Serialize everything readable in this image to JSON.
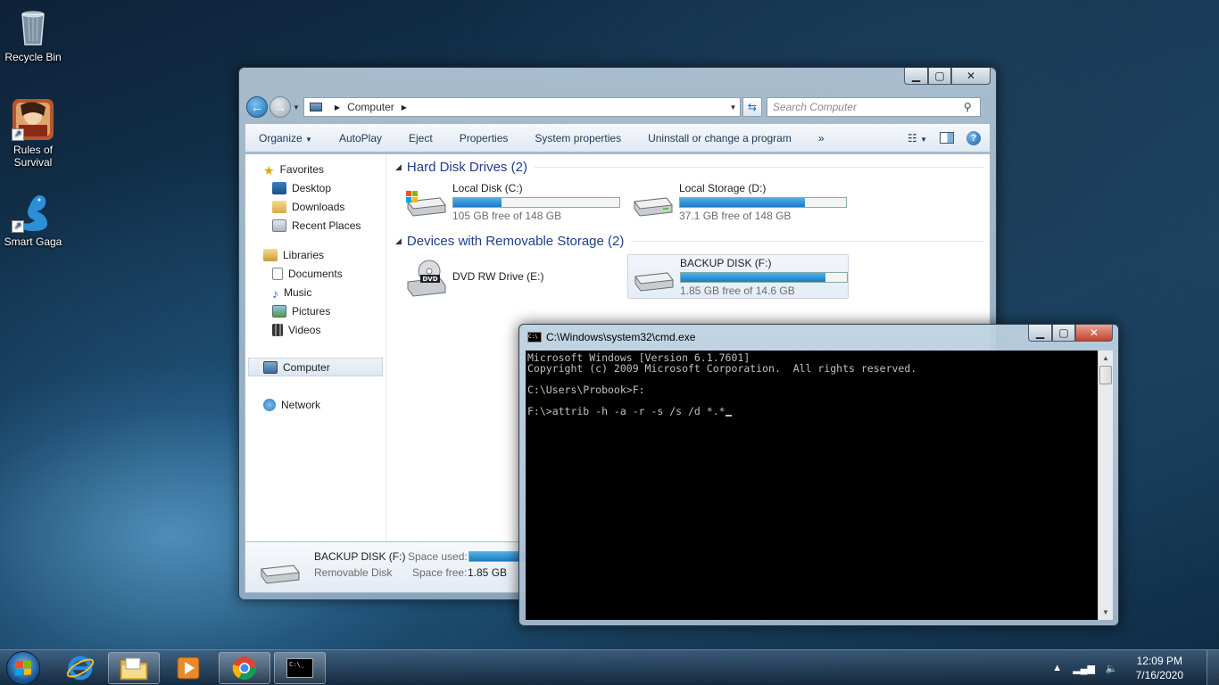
{
  "desktop": {
    "icons": [
      {
        "label": "Recycle Bin",
        "icon": "recycle-bin-icon"
      },
      {
        "label": "Rules of Survival",
        "icon": "rules-of-survival-icon"
      },
      {
        "label": "Smart Gaga",
        "icon": "smart-gaga-icon"
      }
    ]
  },
  "explorer": {
    "address": {
      "location": "Computer"
    },
    "search_placeholder": "Search Computer",
    "toolbar": {
      "organize": "Organize",
      "autoplay": "AutoPlay",
      "eject": "Eject",
      "properties": "Properties",
      "system_properties": "System properties",
      "uninstall": "Uninstall or change a program",
      "more": "»",
      "help": "?"
    },
    "nav": {
      "favorites": "Favorites",
      "desktop": "Desktop",
      "downloads": "Downloads",
      "recent_places": "Recent Places",
      "libraries": "Libraries",
      "documents": "Documents",
      "music": "Music",
      "pictures": "Pictures",
      "videos": "Videos",
      "computer": "Computer",
      "network": "Network"
    },
    "groups": {
      "hdd": "Hard Disk Drives (2)",
      "removable": "Devices with Removable Storage (2)"
    },
    "drives": {
      "c": {
        "name": "Local Disk (C:)",
        "free": "105 GB free of 148 GB",
        "used_fraction": 0.29
      },
      "d": {
        "name": "Local Storage (D:)",
        "free": "37.1 GB free of 148 GB",
        "used_fraction": 0.75
      },
      "e": {
        "name": "DVD RW Drive (E:)",
        "badge": "DVD"
      },
      "f": {
        "name": "BACKUP DISK (F:)",
        "free": "1.85 GB free of 14.6 GB",
        "used_fraction": 0.87
      }
    },
    "details": {
      "name": "BACKUP DISK (F:)",
      "type": "Removable Disk",
      "space_used_label": "Space used:",
      "space_free_label": "Space free:",
      "space_free_value": "1.85 GB",
      "used_fraction": 0.87
    }
  },
  "cmd": {
    "title": "C:\\Windows\\system32\\cmd.exe",
    "lines": [
      "Microsoft Windows [Version 6.1.7601]",
      "Copyright (c) 2009 Microsoft Corporation.  All rights reserved.",
      "",
      "C:\\Users\\Probook>F:",
      "",
      "F:\\>attrib -h -a -r -s /s /d *.*"
    ]
  },
  "taskbar": {
    "clock_time": "12:09 PM",
    "clock_date": "7/16/2020",
    "cmd_icon_text": "C:\\_"
  },
  "colors": {
    "accent_blue": "#1e3f8a",
    "progress_fill": "#1b7cc0",
    "cmd_text": "#c0c0c0"
  }
}
